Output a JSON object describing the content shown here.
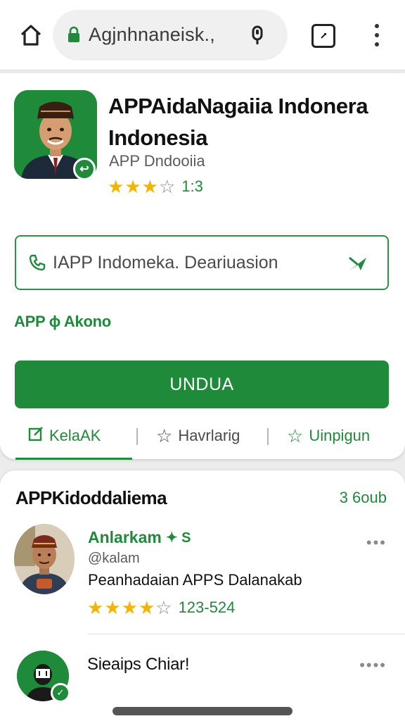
{
  "browser": {
    "url_text": "Agjnhnaneisk.,",
    "icons": [
      "home-icon",
      "lock-icon",
      "mic-icon",
      "tab-switcher-icon",
      "overflow-menu-icon"
    ]
  },
  "app": {
    "title_line1": "APPAidaNagaiia Indonera",
    "title_line2": "Indonesia",
    "developer": "APP Dndooiia",
    "rating": 3.5,
    "rating_text": "1:3",
    "search_text": "IAPP Indomeka. Deariuasion",
    "account_text": "APP ɸ Akono",
    "install_label": "UNDUA",
    "tabs": [
      {
        "label": "KelaAK",
        "icon": "edit-icon"
      },
      {
        "label": "Havrlarig",
        "icon": "star-outline-icon"
      },
      {
        "label": "Uinpigun",
        "icon": "star-outline-icon"
      }
    ]
  },
  "reviews": {
    "title": "APPKidoddaliema",
    "count_text": "3 6oub",
    "items": [
      {
        "name": "Anlarkam",
        "verify_text": "✦ S",
        "handle": "@kalam",
        "text": "Peanhadaian APPS Dalanakab",
        "rating": 4,
        "rating_text": "123-524"
      },
      {
        "name": "Sieaips Chiar!"
      }
    ]
  },
  "colors": {
    "brand_green": "#1e8a3a",
    "star_gold": "#f4b400"
  }
}
